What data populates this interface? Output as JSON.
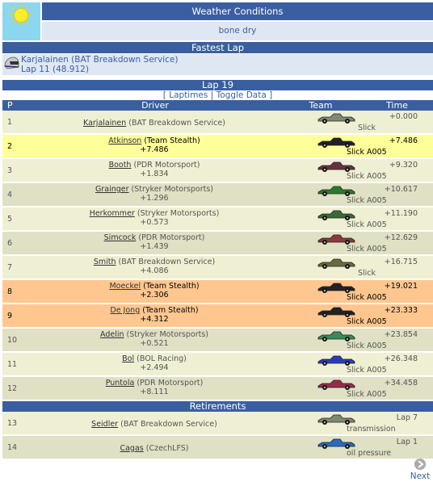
{
  "weather": {
    "title": "Weather Conditions",
    "value": "bone dry",
    "icon": "sun-icon"
  },
  "fastest_lap": {
    "title": "Fastest Lap",
    "driver": "Karjalainen (BAT Breakdown Service)",
    "lap": "Lap 11 (48.912)"
  },
  "lap": {
    "title": "Lap 19",
    "open": "[",
    "laptimes": "Laptimes",
    "sep": "|",
    "toggle": "Toggle Data",
    "close": "]"
  },
  "columns": {
    "p": "P",
    "driver": "Driver",
    "team": "Team",
    "time": "Time"
  },
  "colors": {
    "header_bg": "#3a5fa0",
    "row_default": "#efefd3",
    "row_alt": "#e0e0c4",
    "row_yellow": "#ffff99",
    "row_orange": "#ffc78f"
  },
  "rows": [
    {
      "pos": "1",
      "surname": "Karjalainen",
      "team": "(BAT Breakdown Service)",
      "gap": "",
      "time": "+0.000",
      "tyre": "Slick"
    },
    {
      "pos": "2",
      "surname": "Atkinson",
      "team": "(Team Stealth)",
      "gap": "+7.486",
      "time": "+7.486",
      "tyre": "Slick A005"
    },
    {
      "pos": "3",
      "surname": "Booth",
      "team": "(PDR Motorsport)",
      "gap": "+1.834",
      "time": "+9.320",
      "tyre": "Slick A005"
    },
    {
      "pos": "4",
      "surname": "Grainger",
      "team": "(Stryker Motorsports)",
      "gap": "+1.296",
      "time": "+10.617",
      "tyre": "Slick A005"
    },
    {
      "pos": "5",
      "surname": "Herkommer",
      "team": "(Stryker Motorsports)",
      "gap": "+0.573",
      "time": "+11.190",
      "tyre": "Slick A005"
    },
    {
      "pos": "6",
      "surname": "Simcock",
      "team": "(PDR Motorsport)",
      "gap": "+1.439",
      "time": "+12.629",
      "tyre": "Slick A005"
    },
    {
      "pos": "7",
      "surname": "Smith",
      "team": "(BAT Breakdown Service)",
      "gap": "+4.086",
      "time": "+16.715",
      "tyre": "Slick"
    },
    {
      "pos": "8",
      "surname": "Moeckel",
      "team": "(Team Stealth)",
      "gap": "+2.306",
      "time": "+19.021",
      "tyre": "Slick A005"
    },
    {
      "pos": "9",
      "surname": "De Jong",
      "team": "(Team Stealth)",
      "gap": "+4.312",
      "time": "+23.333",
      "tyre": "Slick A005"
    },
    {
      "pos": "10",
      "surname": "Adelin",
      "team": "(Stryker Motorsports)",
      "gap": "+0.521",
      "time": "+23.854",
      "tyre": "Slick A005"
    },
    {
      "pos": "11",
      "surname": "Bol",
      "team": "(BOL Racing)",
      "gap": "+2.494",
      "time": "+26.348",
      "tyre": "Slick A005"
    },
    {
      "pos": "12",
      "surname": "Puntola",
      "team": "(PDR Motorsport)",
      "gap": "+8.111",
      "time": "+34.458",
      "tyre": "Slick A005"
    }
  ],
  "retirements": {
    "title": "Retirements",
    "rows": [
      {
        "pos": "13",
        "surname": "Seidler",
        "team": "(BAT Breakdown Service)",
        "time": "Lap 7",
        "reason": "transmission"
      },
      {
        "pos": "14",
        "surname": "Cagas",
        "team": "(CzechLFS)",
        "time": "Lap 1",
        "reason": "oil pressure"
      }
    ]
  },
  "next": {
    "label": "Next"
  }
}
